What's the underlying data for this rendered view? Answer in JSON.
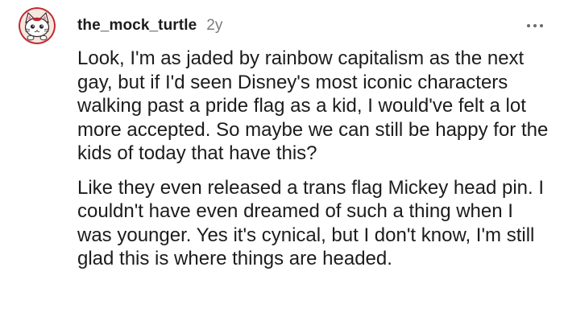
{
  "comment": {
    "author": "the_mock_turtle",
    "age": "2y",
    "paragraphs": [
      "Look, I'm as jaded by rainbow capitalism as the next gay, but if I'd seen Disney's most iconic characters walking past a pride flag as a kid, I would've felt a lot more accepted. So maybe we can still be happy for the kids of today that have this?",
      "Like they even released a trans flag Mickey head pin. I couldn't have even dreamed of such a thing when I was younger. Yes it's cynical, but I don't know, I'm still glad this is where things are headed."
    ]
  },
  "icons": {
    "avatar": "cat-avatar-icon",
    "more": "more-options-icon"
  },
  "colors": {
    "avatar_ring": "#c1272d",
    "avatar_face": "#ffffff",
    "text": "#1c1c1c",
    "meta": "#7c7c7c"
  }
}
